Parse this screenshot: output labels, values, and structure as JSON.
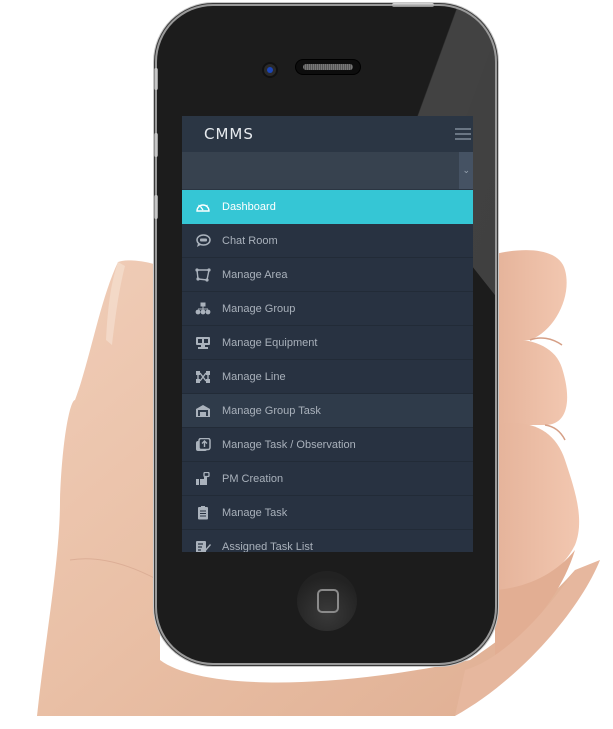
{
  "app": {
    "title": "CMMS",
    "menu_toggle_icon": "hamburger-icon",
    "selector": {
      "value": "",
      "caret_icon": "chevron-down-icon"
    }
  },
  "menu": {
    "items": [
      {
        "label": "Dashboard",
        "icon": "dashboard-gauge-icon",
        "state": "active"
      },
      {
        "label": "Chat Room",
        "icon": "chat-bubble-icon",
        "state": "normal"
      },
      {
        "label": "Manage Area",
        "icon": "area-polygon-icon",
        "state": "normal"
      },
      {
        "label": "Manage Group",
        "icon": "group-hierarchy-icon",
        "state": "normal"
      },
      {
        "label": "Manage Equipment",
        "icon": "equipment-monitor-icon",
        "state": "normal"
      },
      {
        "label": "Manage Line",
        "icon": "line-network-icon",
        "state": "normal"
      },
      {
        "label": "Manage Group Task",
        "icon": "group-task-icon",
        "state": "hover"
      },
      {
        "label": "Manage Task / Observation",
        "icon": "task-observation-icon",
        "state": "normal"
      },
      {
        "label": "PM Creation",
        "icon": "pm-creation-icon",
        "state": "normal"
      },
      {
        "label": "Manage Task",
        "icon": "clipboard-icon",
        "state": "normal"
      },
      {
        "label": "Assigned Task List",
        "icon": "assigned-list-icon",
        "state": "normal"
      }
    ]
  },
  "colors": {
    "accent": "#35c6d5",
    "sidebar_bg": "#283241",
    "header_bg": "#2b3644",
    "text": "#a9b1bb"
  }
}
